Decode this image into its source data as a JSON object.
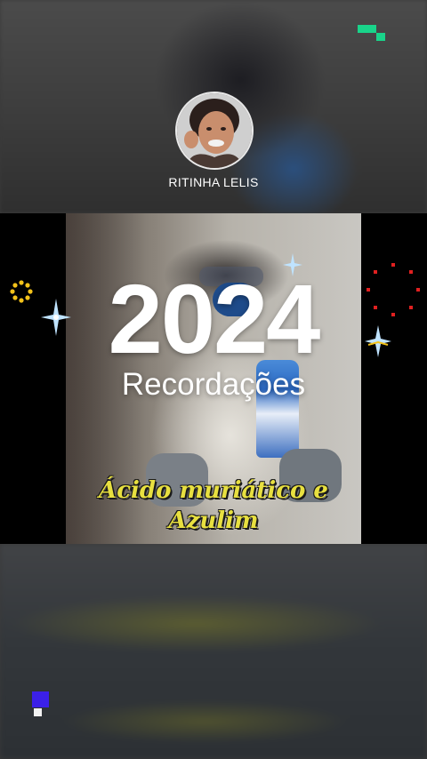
{
  "profile": {
    "name": "RITINHA LELIS"
  },
  "video": {
    "year_title": "2024",
    "subtitle": "Recordações",
    "caption_line1": "Ácido muriático e",
    "caption_line2": "Azulim"
  },
  "icons": {
    "logo": "pixel-logo-icon",
    "sparkle": "sparkle-icon",
    "firework": "firework-icon"
  },
  "colors": {
    "logo_green": "#19d48a",
    "caption_yellow": "#e8e040",
    "firework_red": "#e02020",
    "firework_yellow": "#f3c21a",
    "pixel_blue": "#3b20e8"
  }
}
